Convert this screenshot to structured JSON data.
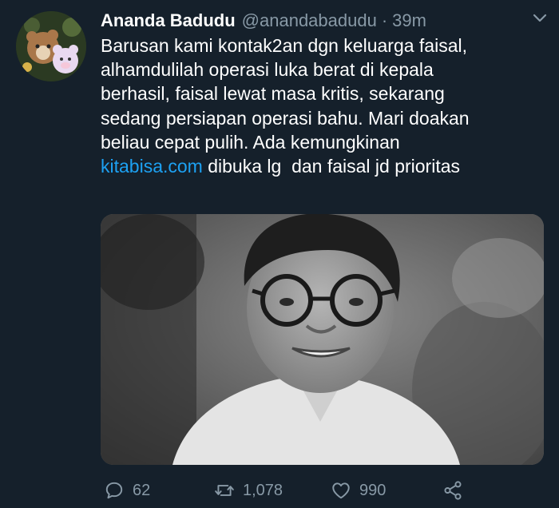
{
  "tweet": {
    "author_name": "Ananda Badudu",
    "handle": "@anandabadudu",
    "separator": "·",
    "time": "39m",
    "text_lines": [
      "Barusan kami kontak2an dgn keluarga faisal,",
      "alhamdulilah operasi  luka berat di kepala",
      "berhasil, faisal lewat masa kritis, sekarang",
      "sedang persiapan operasi bahu. Mari doakan",
      "beliau cepat pulih. Ada kemungkinan"
    ],
    "link_text": "kitabisa.com",
    "last_line_rest": " dibuka lg  dan faisal jd prioritas",
    "reply_count": "62",
    "retweet_count": "1,078",
    "like_count": "990"
  },
  "icons": {
    "avatar": "avatar-image",
    "caret": "chevron-down-icon",
    "reply": "reply-icon",
    "retweet": "retweet-icon",
    "like": "heart-icon",
    "share": "share-icon"
  },
  "colors": {
    "background": "#15202b",
    "text": "#ffffff",
    "muted": "#8899a6",
    "link": "#1da1f2"
  }
}
